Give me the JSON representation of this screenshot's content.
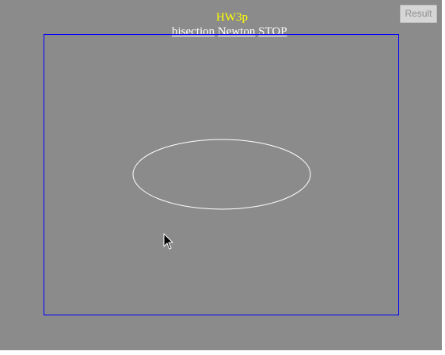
{
  "app": {
    "title": "HW3p"
  },
  "menu": {
    "items": [
      {
        "label": "bisection"
      },
      {
        "label": "Newton"
      },
      {
        "label": "STOP"
      }
    ]
  },
  "toolbar": {
    "result_label": "Result",
    "result_enabled": false
  },
  "colors": {
    "background": "#8b8b8b",
    "title": "#ffff00",
    "menu_text": "#ffffff",
    "canvas_border": "#0000ff",
    "shape_stroke": "#ffffff"
  },
  "canvas": {
    "shape": "ellipse-icon"
  },
  "cursor": {
    "icon": "arrow-cursor-icon"
  }
}
